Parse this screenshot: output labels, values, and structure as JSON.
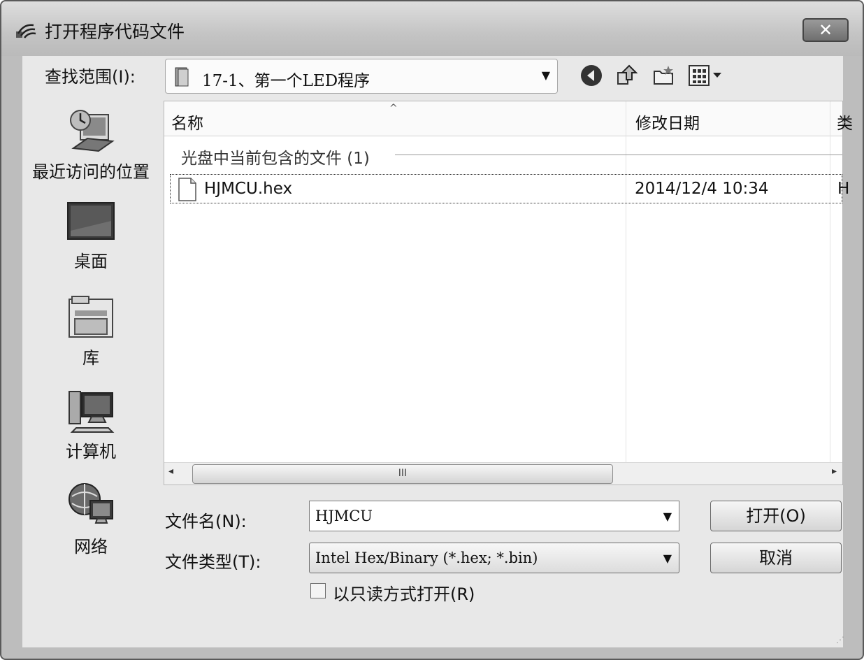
{
  "window": {
    "title": "打开程序代码文件",
    "close_glyph": "✕"
  },
  "lookin": {
    "label": "查找范围(I):",
    "value": "17-1、第一个LED程序",
    "arrow": "▼"
  },
  "places": [
    {
      "label": "最近访问的位置",
      "icon": "recent-places-icon"
    },
    {
      "label": "桌面",
      "icon": "desktop-icon"
    },
    {
      "label": "库",
      "icon": "libraries-icon"
    },
    {
      "label": "计算机",
      "icon": "computer-icon"
    },
    {
      "label": "网络",
      "icon": "network-icon"
    }
  ],
  "filelist": {
    "columns": {
      "name": "名称",
      "date": "修改日期",
      "more": "类"
    },
    "sort_indicator": "^",
    "group_header": "光盘中当前包含的文件 (1)",
    "rows": [
      {
        "name": "HJMCU.hex",
        "date": "2014/12/4 10:34",
        "more": "H"
      }
    ],
    "scroll": {
      "left": "◂",
      "right": "▸",
      "grip": "III"
    }
  },
  "form": {
    "filename_label": "文件名(N):",
    "filename_value": "HJMCU",
    "filetype_label": "文件类型(T):",
    "filetype_value": "Intel Hex/Binary (*.hex; *.bin)",
    "dropdown_arrow": "▼",
    "readonly_label": "以只读方式打开(R)",
    "readonly_checked": false
  },
  "buttons": {
    "open": "打开(O)",
    "cancel": "取消"
  },
  "colors": {
    "window_bg": "#bdbdbd",
    "panel_bg": "#e8e8e8",
    "list_bg": "#ffffff"
  }
}
